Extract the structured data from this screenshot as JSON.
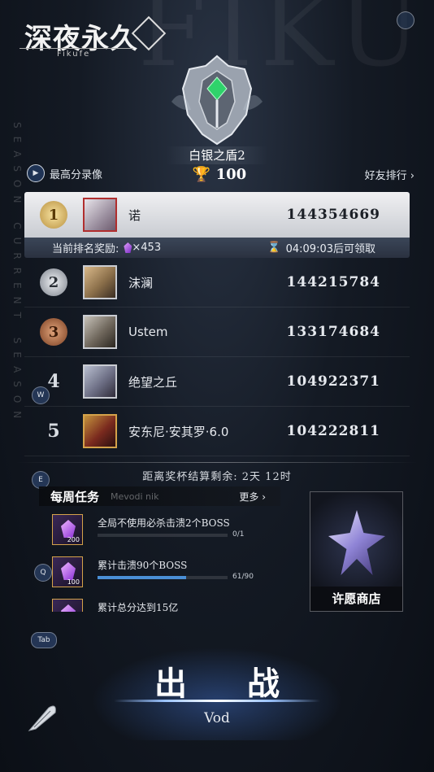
{
  "logo": {
    "title": "深夜永久",
    "subtitle": "Fikufe"
  },
  "background": {
    "letters": "FIKU",
    "vertical_text": "SEASON CURRENT SEASON"
  },
  "rank": {
    "tier_name": "白银之盾2",
    "trophies": "100"
  },
  "replay_label": "最高分录像",
  "friends_label": "好友排行",
  "leaderboard": [
    {
      "rank": "1",
      "name": "诺",
      "score": "144354669"
    },
    {
      "rank": "2",
      "name": "沫澜",
      "score": "144215784"
    },
    {
      "rank": "3",
      "name": "Ustem",
      "score": "133174684"
    },
    {
      "rank": "4",
      "name": "绝望之丘",
      "score": "104922371"
    },
    {
      "rank": "5",
      "name": "安东尼·安其罗·6.0",
      "score": "104222811"
    }
  ],
  "reward": {
    "label": "当前排名奖励:",
    "amount": "×453",
    "time": "04:09:03后可领取"
  },
  "keys": {
    "w": "W",
    "e": "E",
    "q": "Q",
    "tab": "Tab"
  },
  "countdown": "距离奖杯结算剩余: 2天 12时",
  "weekly": {
    "title": "每周任务",
    "subtitle": "Mevodi nik",
    "more": "更多",
    "tasks": [
      {
        "name": "全局不使用必杀击溃2个BOSS",
        "progress_text": "0/1",
        "progress": 0.0,
        "reward_qty": "200"
      },
      {
        "name": "累计击溃90个BOSS",
        "progress_text": "61/90",
        "progress": 0.68,
        "reward_qty": "100"
      },
      {
        "name": "累计总分达到15亿",
        "progress_text": "",
        "progress": 0.0,
        "reward_qty": ""
      }
    ]
  },
  "shop_label": "许愿商店",
  "battle": {
    "label": "出 战",
    "sub": "Vod"
  }
}
